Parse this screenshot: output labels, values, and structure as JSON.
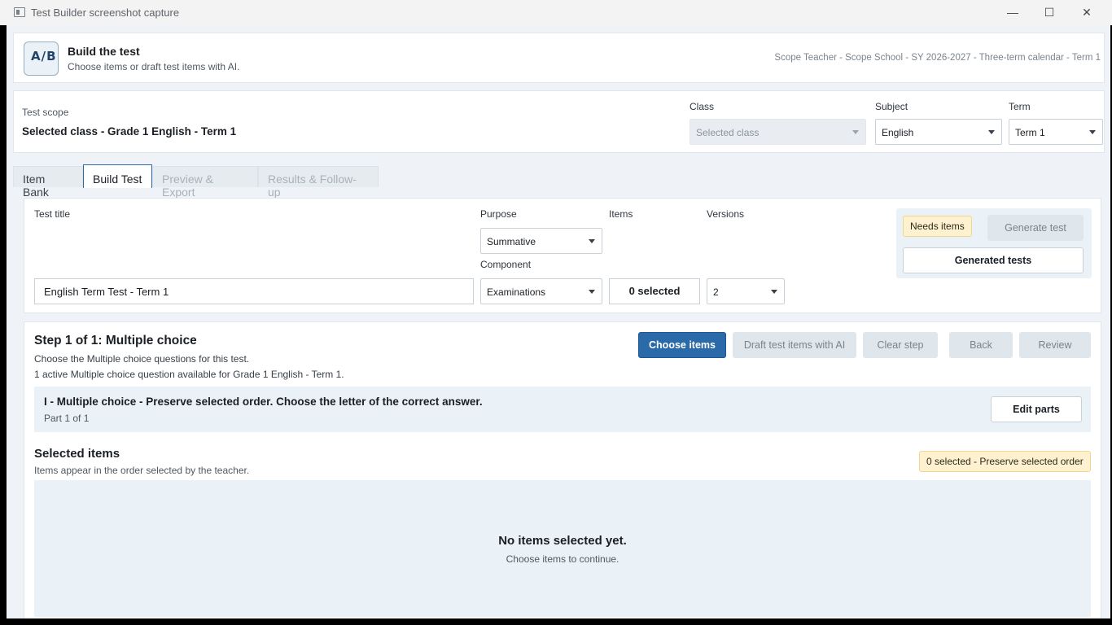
{
  "window": {
    "title": "Test Builder screenshot capture",
    "controls": {
      "minimize": "—",
      "maximize": "☐",
      "close": "✕"
    }
  },
  "header": {
    "logo_text": "A/B",
    "title": "Build the test",
    "subtitle": "Choose items or draft test items with AI.",
    "meta": "Scope Teacher - Scope School - SY 2026-2027 - Three-term calendar - Term 1"
  },
  "scope": {
    "label": "Test scope",
    "value": "Selected class - Grade 1 English - Term 1",
    "class": {
      "label": "Class",
      "value": "Selected class"
    },
    "subject": {
      "label": "Subject",
      "value": "English"
    },
    "term": {
      "label": "Term",
      "value": "Term 1"
    }
  },
  "tabs": [
    {
      "label": "Item Bank"
    },
    {
      "label": "Build Test"
    },
    {
      "label": "Preview & Export"
    },
    {
      "label": "Results & Follow-up"
    }
  ],
  "build": {
    "test_title_label": "Test title",
    "test_title_value": "English Term Test - Term 1",
    "purpose_label": "Purpose",
    "purpose_value": "Summative",
    "component_label": "Component",
    "component_value": "Examinations",
    "items_label": "Items",
    "items_value": "0 selected",
    "versions_label": "Versions",
    "versions_value": "2",
    "status_badge": "Needs items",
    "generate_test": "Generate test",
    "generated_tests": "Generated tests"
  },
  "step": {
    "title": "Step 1 of 1: Multiple choice",
    "description": "Choose the Multiple choice questions for this test.",
    "availability": "1 active Multiple choice question available for Grade 1 English - Term 1.",
    "buttons": {
      "choose_items": "Choose items",
      "draft_ai": "Draft test items with AI",
      "clear_step": "Clear step",
      "back": "Back",
      "review": "Review"
    },
    "part": {
      "title": "I - Multiple choice - Preserve selected order. Choose the letter of the correct answer.",
      "subtitle": "Part 1 of 1",
      "edit_parts": "Edit parts"
    },
    "selected": {
      "title": "Selected items",
      "subtitle": "Items appear in the order selected by the teacher.",
      "badge": "0 selected - Preserve selected order",
      "empty_title": "No items selected yet.",
      "empty_subtitle": "Choose items to continue."
    }
  },
  "icons": {
    "app": "app-window-icon",
    "caret": "chevron-down-icon"
  },
  "colors": {
    "primary": "#2a6aa8",
    "warning_bg": "#fdf1cf",
    "panel_bg": "#eaf1f7"
  }
}
